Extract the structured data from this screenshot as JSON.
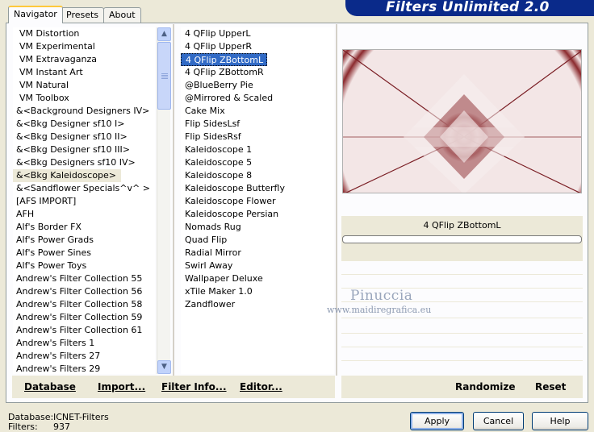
{
  "tabs": [
    "Navigator",
    "Presets",
    "About"
  ],
  "app_title": "Filters Unlimited 2.0",
  "categories": [
    "VM Distortion",
    "VM Experimental",
    "VM Extravaganza",
    "VM Instant Art",
    "VM Natural",
    "VM Toolbox",
    "&<Background Designers IV>",
    "&<Bkg Designer sf10 I>",
    "&<Bkg Designer sf10 II>",
    "&<Bkg Designer sf10 III>",
    "&<Bkg Designers sf10 IV>",
    "&<Bkg Kaleidoscope>",
    "&<Sandflower Specials^v^ >",
    "[AFS IMPORT]",
    "AFH",
    "Alf's Border FX",
    "Alf's Power Grads",
    "Alf's Power Sines",
    "Alf's Power Toys",
    "Andrew's Filter Collection 55",
    "Andrew's Filter Collection 56",
    "Andrew's Filter Collection 58",
    "Andrew's Filter Collection 59",
    "Andrew's Filter Collection 61",
    "Andrew's Filters 1",
    "Andrew's Filters 27",
    "Andrew's Filters 29"
  ],
  "selected_category": "&<Bkg Kaleidoscope>",
  "filters": [
    "4 QFlip UpperL",
    "4 QFlip UpperR",
    "4 QFlip ZBottomL",
    "4 QFlip ZBottomR",
    "@BlueBerry Pie",
    "@Mirrored & Scaled",
    "Cake Mix",
    "Flip SidesLsf",
    "Flip SidesRsf",
    "Kaleidoscope 1",
    "Kaleidoscope 5",
    "Kaleidoscope 8",
    "Kaleidoscope Butterfly",
    "Kaleidoscope Flower",
    "Kaleidoscope Persian",
    "Nomads Rug",
    "Quad Flip",
    "Radial Mirror",
    "Swirl Away",
    "Wallpaper Deluxe",
    "xTile Maker 1.0",
    "Zandflower"
  ],
  "selected_filter": "4 QFlip ZBottomL",
  "preview_filter_name": "4 QFlip ZBottomL",
  "watermark": {
    "name": "Pinuccia",
    "url": "www.maidiregrafica.eu"
  },
  "toolbar": {
    "database": "Database",
    "import": "Import...",
    "filter_info": "Filter Info...",
    "editor": "Editor...",
    "randomize": "Randomize",
    "reset": "Reset"
  },
  "status": {
    "database_label": "Database:",
    "database_value": "ICNET-Filters",
    "filters_label": "Filters:",
    "filters_value": "937"
  },
  "buttons": {
    "apply": "Apply",
    "cancel": "Cancel",
    "help": "Help"
  },
  "colors": {
    "selection": "#316ac5",
    "banner": "#0a2a8a",
    "preview_dark": "#8b2a2e",
    "preview_light": "#f3e6e6"
  }
}
